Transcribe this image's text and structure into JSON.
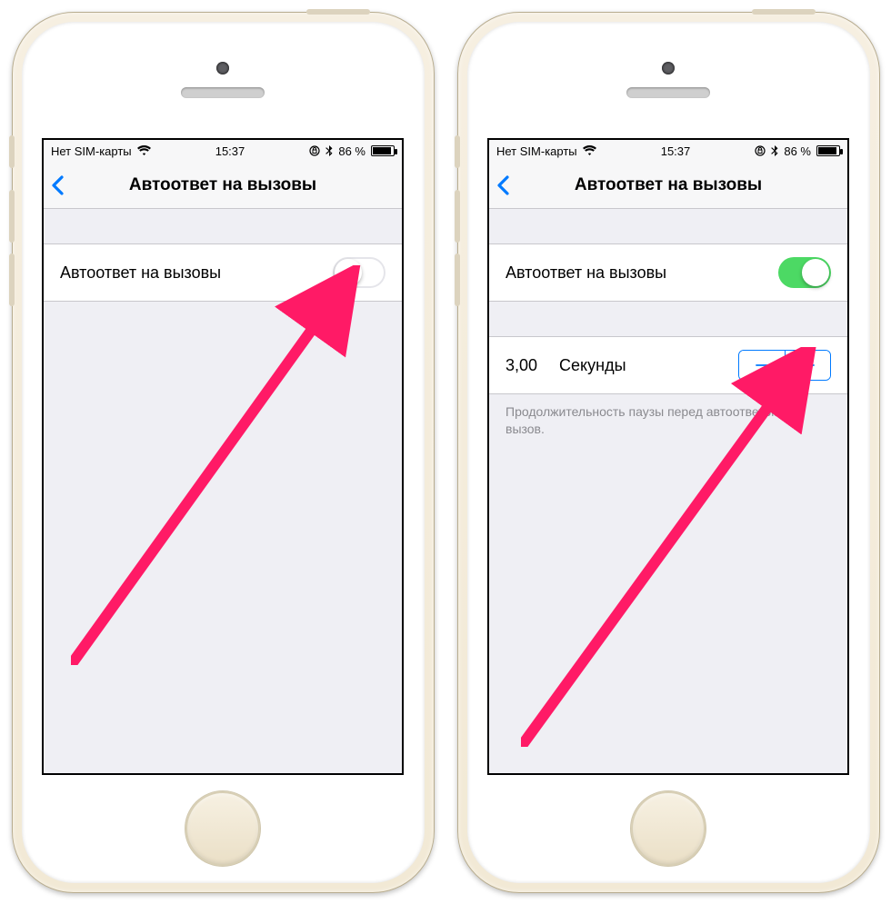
{
  "status": {
    "carrier": "Нет SIM-карты",
    "time": "15:37",
    "battery_pct": "86 %"
  },
  "nav": {
    "title": "Автоответ на вызовы"
  },
  "phone_left": {
    "toggle_label": "Автоответ на вызовы",
    "toggle_on": false
  },
  "phone_right": {
    "toggle_label": "Автоответ на вызовы",
    "toggle_on": true,
    "seconds_value": "3,00",
    "seconds_unit": "Секунды",
    "footer": "Продолжительность паузы перед автоответом на вызов."
  },
  "colors": {
    "ios_blue": "#007aff",
    "ios_green": "#4cd964",
    "arrow": "#ff1a66"
  }
}
